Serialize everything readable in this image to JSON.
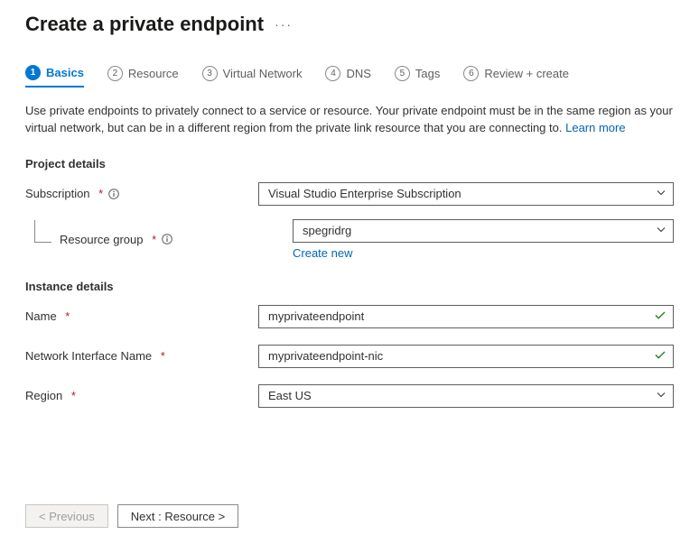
{
  "title": "Create a private endpoint",
  "tabs": [
    {
      "num": "1",
      "label": "Basics"
    },
    {
      "num": "2",
      "label": "Resource"
    },
    {
      "num": "3",
      "label": "Virtual Network"
    },
    {
      "num": "4",
      "label": "DNS"
    },
    {
      "num": "5",
      "label": "Tags"
    },
    {
      "num": "6",
      "label": "Review + create"
    }
  ],
  "description": "Use private endpoints to privately connect to a service or resource. Your private endpoint must be in the same region as your virtual network, but can be in a different region from the private link resource that you are connecting to.",
  "learn_more": "Learn more",
  "sections": {
    "project": "Project details",
    "instance": "Instance details"
  },
  "fields": {
    "subscription": {
      "label": "Subscription",
      "value": "Visual Studio Enterprise Subscription"
    },
    "resource_group": {
      "label": "Resource group",
      "value": "spegridrg",
      "create_new": "Create new"
    },
    "name": {
      "label": "Name",
      "value": "myprivateendpoint"
    },
    "nic_name": {
      "label": "Network Interface Name",
      "value": "myprivateendpoint-nic"
    },
    "region": {
      "label": "Region",
      "value": "East US"
    }
  },
  "footer": {
    "previous": "< Previous",
    "next": "Next : Resource >"
  }
}
